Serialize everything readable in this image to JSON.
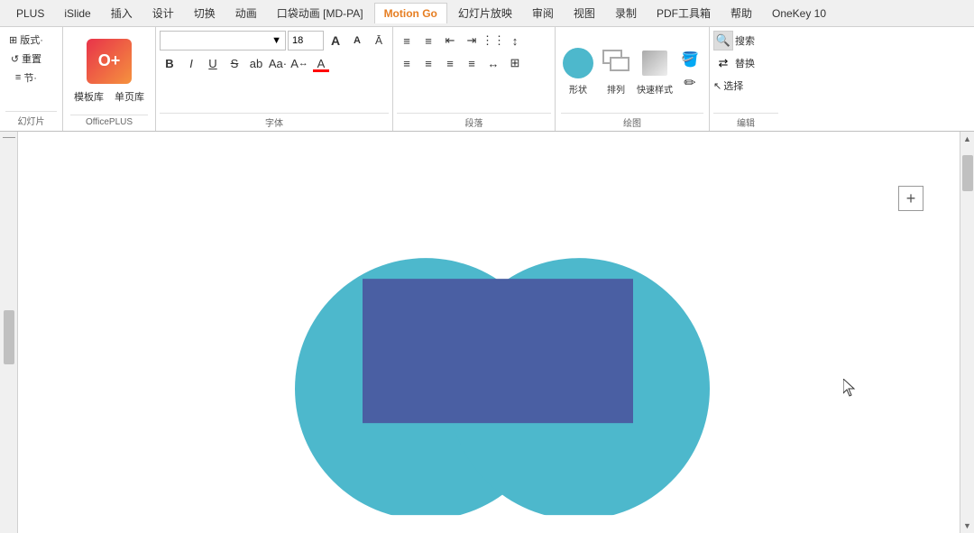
{
  "titlebar": {
    "tabs": [
      {
        "label": "PLUS",
        "active": false
      },
      {
        "label": "iSlide",
        "active": false
      },
      {
        "label": "插入",
        "active": false
      },
      {
        "label": "设计",
        "active": false
      },
      {
        "label": "切换",
        "active": false
      },
      {
        "label": "动画",
        "active": false
      },
      {
        "label": "口袋动画 [MD-PA]",
        "active": false
      },
      {
        "label": "Motion Go",
        "active": true,
        "highlight": true
      },
      {
        "label": "幻灯片放映",
        "active": false
      },
      {
        "label": "审阅",
        "active": false
      },
      {
        "label": "视图",
        "active": false
      },
      {
        "label": "录制",
        "active": false
      },
      {
        "label": "PDF工具箱",
        "active": false
      },
      {
        "label": "帮助",
        "active": false
      },
      {
        "label": "OneKey 10",
        "active": false
      }
    ]
  },
  "ribbon": {
    "left_group": {
      "label": "幻灯片",
      "buttons": [
        {
          "id": "layout",
          "text": "版式·"
        },
        {
          "id": "reset",
          "text": "重置"
        },
        {
          "id": "section",
          "text": "节·"
        }
      ],
      "section_label": "幻灯片"
    },
    "officeplus_label": "OfficePLUS",
    "template_btn": "模板库",
    "page_btn": "单页库",
    "font_section_label": "字体",
    "para_section_label": "段落",
    "draw_section_label": "绘图",
    "edit_section_label": "编辑",
    "font_name": "",
    "font_size": "18",
    "format_buttons": [
      "B",
      "I",
      "U",
      "S",
      "ab",
      "Aa·",
      "A·"
    ],
    "shape_btn": "形状",
    "arrange_btn": "排列",
    "style_btn": "快速样式",
    "search_placeholder": "搜索",
    "replace_label": "替换"
  },
  "canvas": {
    "plus_button": "+",
    "cursor": "▲"
  },
  "shapes": {
    "circle_color": "#4db8cc",
    "rect_color": "#4a5fa3",
    "description": "Two overlapping circles (teal) with a blue rectangle overlapping the top portion"
  }
}
